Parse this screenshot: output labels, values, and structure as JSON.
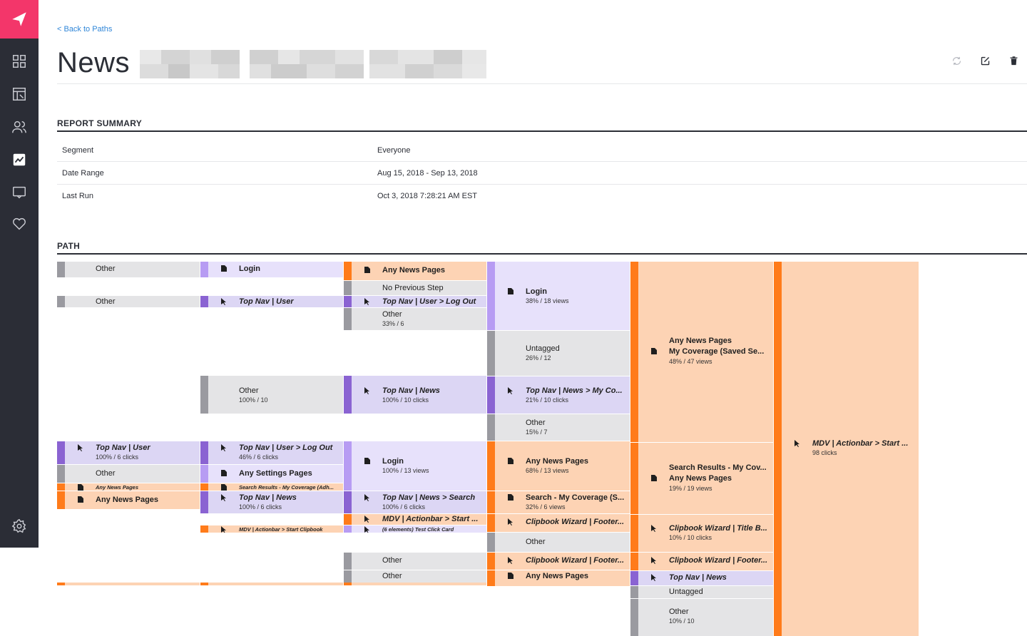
{
  "nav": {
    "items": [
      "dashboard",
      "reports",
      "people",
      "analytics",
      "feedback",
      "favorites",
      "settings"
    ]
  },
  "header": {
    "back_link": "< Back to Paths",
    "title": "News"
  },
  "summary": {
    "heading": "REPORT SUMMARY",
    "rows": [
      {
        "label": "Segment",
        "value": "Everyone"
      },
      {
        "label": "Date Range",
        "value": "Aug 15, 2018 - Sep 13, 2018"
      },
      {
        "label": "Last Run",
        "value": "Oct 3, 2018 7:28:21 AM EST"
      }
    ]
  },
  "path": {
    "heading": "PATH",
    "nodes": [
      {
        "l1": "Other"
      },
      {
        "l1": "Other"
      },
      {
        "l1": "Top Nav | User",
        "l2": "100% / 6 clicks"
      },
      {
        "l1": "Other"
      },
      {
        "l1": "Any News Pages"
      },
      {
        "l1": "Any News Pages"
      },
      {
        "l1": "Login"
      },
      {
        "l1": "Top Nav | User"
      },
      {
        "l1": "Other",
        "l2": "100% / 10"
      },
      {
        "l1": "Top Nav | User > Log Out",
        "l2": "46% / 6 clicks"
      },
      {
        "l1": "Any Settings Pages"
      },
      {
        "l1": "Search Results - My Coverage (Adh..."
      },
      {
        "l1": "Top Nav | News",
        "l2": "100% / 6 clicks"
      },
      {
        "l1": "MDV | Actionbar > Start Clipbook"
      },
      {
        "l1": "Any News Pages"
      },
      {
        "l1": "No Previous Step"
      },
      {
        "l1": "Top Nav | User > Log Out"
      },
      {
        "l1": "Other",
        "l2": "33% / 6"
      },
      {
        "l1": "Top Nav | News",
        "l2": "100% / 10 clicks"
      },
      {
        "l1": "Login",
        "l2": "100% / 13 views"
      },
      {
        "l1": "Top Nav | News > Search",
        "l2": "100% / 6 clicks"
      },
      {
        "l1": "MDV | Actionbar > Start ..."
      },
      {
        "l1": "(6 elements) Test Click Card"
      },
      {
        "l1": "Other"
      },
      {
        "l1": "Other"
      },
      {
        "l1": "Login",
        "l2": "38% / 18 views"
      },
      {
        "l1": "Untagged",
        "l2": "26% / 12"
      },
      {
        "l1": "Top Nav | News > My Co...",
        "l2": "21% / 10 clicks"
      },
      {
        "l1": "Other",
        "l2": "15% / 7"
      },
      {
        "l1": "Any News Pages",
        "l2": "68% / 13 views"
      },
      {
        "l1": "Search - My Coverage (S...",
        "l2": "32% / 6 views"
      },
      {
        "l1": "Clipbook Wizard | Footer..."
      },
      {
        "l1": "Other"
      },
      {
        "l1": "Clipbook Wizard | Footer..."
      },
      {
        "l1": "Any News Pages"
      },
      {
        "l1": "Any News Pages",
        "l1b": "My Coverage (Saved Se...",
        "l2": "48% / 47 views"
      },
      {
        "l1": "Search Results - My Cov...",
        "l1b": "Any News Pages",
        "l2": "19% / 19 views"
      },
      {
        "l1": "Clipbook Wizard | Title B...",
        "l2": "10% / 10 clicks"
      },
      {
        "l1": "Clipbook Wizard | Footer..."
      },
      {
        "l1": "Top Nav | News"
      },
      {
        "l1": "Untagged"
      },
      {
        "l1": "Other",
        "l2": "10% / 10"
      },
      {
        "l1": "MDV | Actionbar > Start ...",
        "l2": "98 clicks"
      }
    ]
  },
  "colors": {
    "accent": "#f3366a",
    "sidebar": "#2b2d36",
    "link": "#2f86d8",
    "orange": "#ff7b1a",
    "purple": "#8a63d2",
    "gray": "#9a9aa0"
  }
}
